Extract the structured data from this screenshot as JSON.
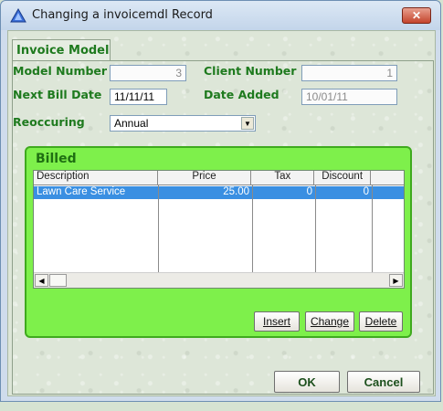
{
  "window": {
    "title": "Changing a invoicemdl Record",
    "close_label": "✕"
  },
  "tabs": [
    {
      "label": "Invoice Model",
      "selected": true
    }
  ],
  "form": {
    "model_number": {
      "label": "Model Number",
      "value": "3"
    },
    "client_number": {
      "label": "Client Number",
      "value": "1"
    },
    "next_bill_date": {
      "label": "Next Bill Date",
      "value": "11/11/11"
    },
    "date_added": {
      "label": "Date Added",
      "value": "10/01/11"
    },
    "reoccuring": {
      "label": "Reoccuring",
      "value": "Annual"
    }
  },
  "billed": {
    "title": "Billed",
    "columns": [
      "Description",
      "Price",
      "Tax",
      "Discount"
    ],
    "rows": [
      {
        "description": "Lawn Care Service",
        "price": "25.00",
        "tax": "0",
        "discount": "0"
      }
    ],
    "buttons": {
      "insert": "Insert",
      "change": "Change",
      "delete": "Delete"
    }
  },
  "actions": {
    "ok": "OK",
    "cancel": "Cancel"
  }
}
